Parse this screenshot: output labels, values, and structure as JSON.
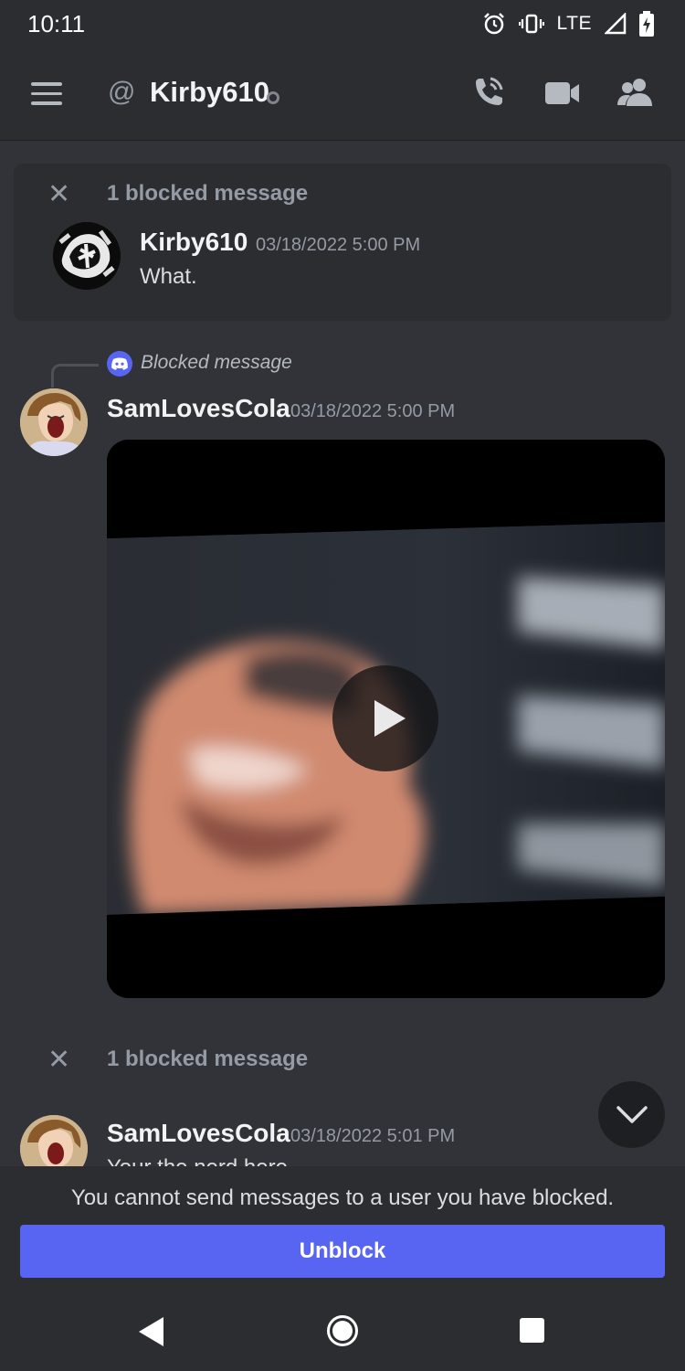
{
  "status_bar": {
    "time": "10:11",
    "network": "LTE",
    "icons": [
      "alarm-icon",
      "vibrate-icon",
      "signal-icon",
      "battery-charging-icon"
    ]
  },
  "header": {
    "channel_icon": "at-icon",
    "title": "Kirby610",
    "presence": "offline",
    "actions": [
      "voice-call-icon",
      "video-call-icon",
      "members-icon"
    ]
  },
  "messages": {
    "blocked_group_1": {
      "label": "1 blocked message",
      "author": "Kirby610",
      "timestamp": "03/18/2022 5:00 PM",
      "content": "What."
    },
    "reply": {
      "text": "Blocked message"
    },
    "message_2": {
      "author": "SamLovesCola",
      "timestamp": "03/18/2022 5:00 PM",
      "attachment": "video"
    },
    "blocked_group_2": {
      "label": "1 blocked message"
    },
    "message_3": {
      "author": "SamLovesCola",
      "timestamp": "03/18/2022 5:01 PM",
      "content": "Your the nerd here"
    }
  },
  "composer": {
    "notice": "You cannot send messages to a user you have blocked.",
    "unblock_label": "Unblock"
  },
  "colors": {
    "background": "#313338",
    "panel": "#2b2d31",
    "accent": "#5865f2",
    "muted_text": "#949ba4"
  }
}
